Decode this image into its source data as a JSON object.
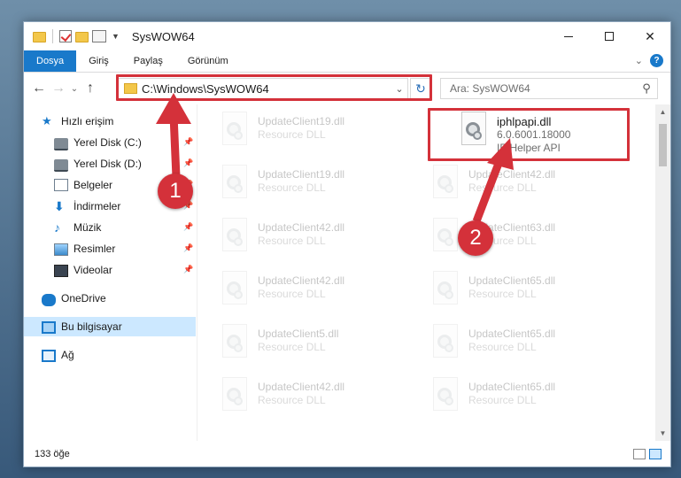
{
  "window": {
    "title": "SysWOW64",
    "controls": {
      "minimize": "–",
      "maximize": "□",
      "close": "✕"
    }
  },
  "ribbon": {
    "tabs": [
      "Dosya",
      "Giriş",
      "Paylaş",
      "Görünüm"
    ],
    "help": "?"
  },
  "address": {
    "path": "C:\\Windows\\SysWOW64"
  },
  "search": {
    "placeholder": "Ara: SysWOW64"
  },
  "nav": {
    "quick_access": "Hızlı erişim",
    "items": [
      {
        "label": "Yerel Disk (C:)",
        "icon": "drive-icon"
      },
      {
        "label": "Yerel Disk (D:)",
        "icon": "drive-icon"
      },
      {
        "label": "Belgeler",
        "icon": "documents-icon"
      },
      {
        "label": "İndirmeler",
        "icon": "downloads-icon"
      },
      {
        "label": "Müzik",
        "icon": "music-icon"
      },
      {
        "label": "Resimler",
        "icon": "pictures-icon"
      },
      {
        "label": "Videolar",
        "icon": "videos-icon"
      }
    ],
    "onedrive": "OneDrive",
    "this_pc": "Bu bilgisayar",
    "network": "Ağ"
  },
  "files": {
    "highlighted": {
      "name": "iphlpapi.dll",
      "version": "6.0.6001.18000",
      "desc": "IP Helper API"
    },
    "left_column": [
      {
        "name": "UpdateClient19.dll",
        "desc": "Resource DLL"
      },
      {
        "name": "UpdateClient19.dll",
        "desc": "Resource DLL"
      },
      {
        "name": "UpdateClient42.dll",
        "desc": "Resource DLL"
      },
      {
        "name": "UpdateClient42.dll",
        "desc": "Resource DLL"
      },
      {
        "name": "UpdateClient5.dll",
        "desc": "Resource DLL"
      },
      {
        "name": "UpdateClient42.dll",
        "desc": "Resource DLL"
      }
    ],
    "right_column": [
      {
        "name": "UpdateClient42.dll",
        "desc": "Resource DLL"
      },
      {
        "name": "UpdateClient63.dll",
        "desc": "Resource DLL"
      },
      {
        "name": "UpdateClient65.dll",
        "desc": "Resource DLL"
      },
      {
        "name": "UpdateClient65.dll",
        "desc": "Resource DLL"
      },
      {
        "name": "UpdateClient65.dll",
        "desc": "Resource DLL"
      }
    ]
  },
  "annotations": {
    "marker1": "1",
    "marker2": "2",
    "color": "#d4313a"
  },
  "status": {
    "count": "133 öğe"
  },
  "colors": {
    "accent": "#1979ca",
    "selected_bg": "#cce8ff"
  }
}
